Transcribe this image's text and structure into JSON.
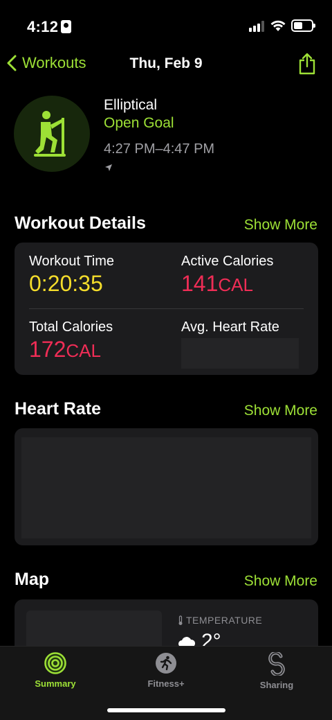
{
  "status_bar": {
    "time": "4:12"
  },
  "nav": {
    "back_label": "Workouts",
    "title": "Thu, Feb 9"
  },
  "workout": {
    "type": "Elliptical",
    "goal": "Open Goal",
    "time_range": "4:27 PM–4:47 PM"
  },
  "details": {
    "title": "Workout Details",
    "show_more": "Show More",
    "workout_time_label": "Workout Time",
    "workout_time_value": "0:20:35",
    "active_calories_label": "Active Calories",
    "active_calories_value": "141",
    "active_calories_unit": "CAL",
    "total_calories_label": "Total Calories",
    "total_calories_value": "172",
    "total_calories_unit": "CAL",
    "avg_heart_rate_label": "Avg. Heart Rate"
  },
  "heart_rate": {
    "title": "Heart Rate",
    "show_more": "Show More"
  },
  "map": {
    "title": "Map",
    "show_more": "Show More",
    "temperature_label": "TEMPERATURE",
    "temperature_value": "2°"
  },
  "tabs": [
    {
      "label": "Summary",
      "icon": "activity-rings-icon",
      "active": true
    },
    {
      "label": "Fitness+",
      "icon": "fitness-plus-icon",
      "active": false
    },
    {
      "label": "Sharing",
      "icon": "sharing-icon",
      "active": false
    }
  ],
  "colors": {
    "accent_green": "#9de036",
    "move_red": "#ef2d56",
    "time_yellow": "#f5dd2b",
    "card_bg": "#1c1c1e"
  }
}
